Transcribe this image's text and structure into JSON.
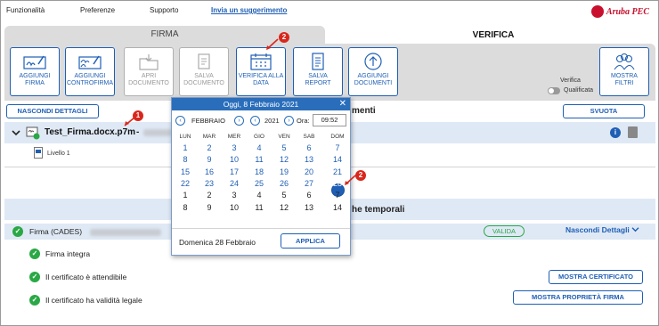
{
  "menu": {
    "items": [
      "Funzionalità",
      "Preferenze",
      "Supporto"
    ],
    "suggest_link": "Invia un suggerimento",
    "logo": "Aruba PEC"
  },
  "tabs": {
    "firma": "FIRMA",
    "verifica": "VERIFICA"
  },
  "toolbar": {
    "aggiungi_firma": [
      "AGGIUNGI",
      "FIRMA"
    ],
    "aggiungi_controfirma": [
      "AGGIUNGI",
      "CONTROFIRMA"
    ],
    "apri_documento": [
      "APRI",
      "DOCUMENTO"
    ],
    "salva_documento": [
      "SALVA",
      "DOCUMENTO"
    ],
    "verifica_alla_data": [
      "VERIFICA ALLA",
      "DATA"
    ],
    "salva_report": [
      "SALVA",
      "REPORT"
    ],
    "aggiungi_documenti": [
      "AGGIUNGI",
      "DOCUMENTI"
    ],
    "mostra_filtri": [
      "MOSTRA",
      "FILTRI"
    ],
    "verifica_label": "Verifica",
    "qualificata_label": "Qualificata"
  },
  "section1": {
    "nascondi_dettagli": "NASCONDI DETTAGLI",
    "title_tail": "menti",
    "svuota": "SVUOTA",
    "file_name": "Test_Firma.docx.p7m",
    "file_sep": "-",
    "livello": "Livello 1"
  },
  "section2": {
    "title_tail": "he temporali",
    "firma_label": "Firma (CADES)",
    "status": "VALIDA",
    "nascondi_link": "Nascondi Dettagli",
    "details": [
      "Firma integra",
      "Il certificato è attendibile",
      "Il certificato ha validità legale"
    ],
    "mostra_certificato": "MOSTRA CERTIFICATO",
    "mostra_proprieta": "MOSTRA PROPRIETÀ FIRMA"
  },
  "picker": {
    "header": "Oggi, 8 Febbraio 2021",
    "month": "FEBBRAIO",
    "year": "2021",
    "ora_label": "Ora:",
    "ora_value": "09:52",
    "weekdays": [
      "LUN",
      "MAR",
      "MER",
      "GIO",
      "VEN",
      "SAB",
      "DOM"
    ],
    "weeks": [
      [
        "1",
        "2",
        "3",
        "4",
        "5",
        "6",
        "7"
      ],
      [
        "8",
        "9",
        "10",
        "11",
        "12",
        "13",
        "14"
      ],
      [
        "15",
        "16",
        "17",
        "18",
        "19",
        "20",
        "21"
      ],
      [
        "22",
        "23",
        "24",
        "25",
        "26",
        "27",
        "28"
      ],
      [
        "1",
        "2",
        "3",
        "4",
        "5",
        "6",
        "7"
      ],
      [
        "8",
        "9",
        "10",
        "11",
        "12",
        "13",
        "14"
      ]
    ],
    "selected_label": "Domenica 28 Febbraio",
    "applica": "APPLICA"
  },
  "callouts": {
    "one": "1",
    "two_a": "2",
    "two_b": "2"
  },
  "icons": [
    "check-icon",
    "info-icon",
    "trash-icon",
    "close-icon",
    "calendar-icon",
    "chevron-down-icon"
  ],
  "colors": {
    "accent": "#1f5fb5",
    "valid": "#2aa845",
    "callout": "#d9271c",
    "brand": "#c8102e"
  }
}
